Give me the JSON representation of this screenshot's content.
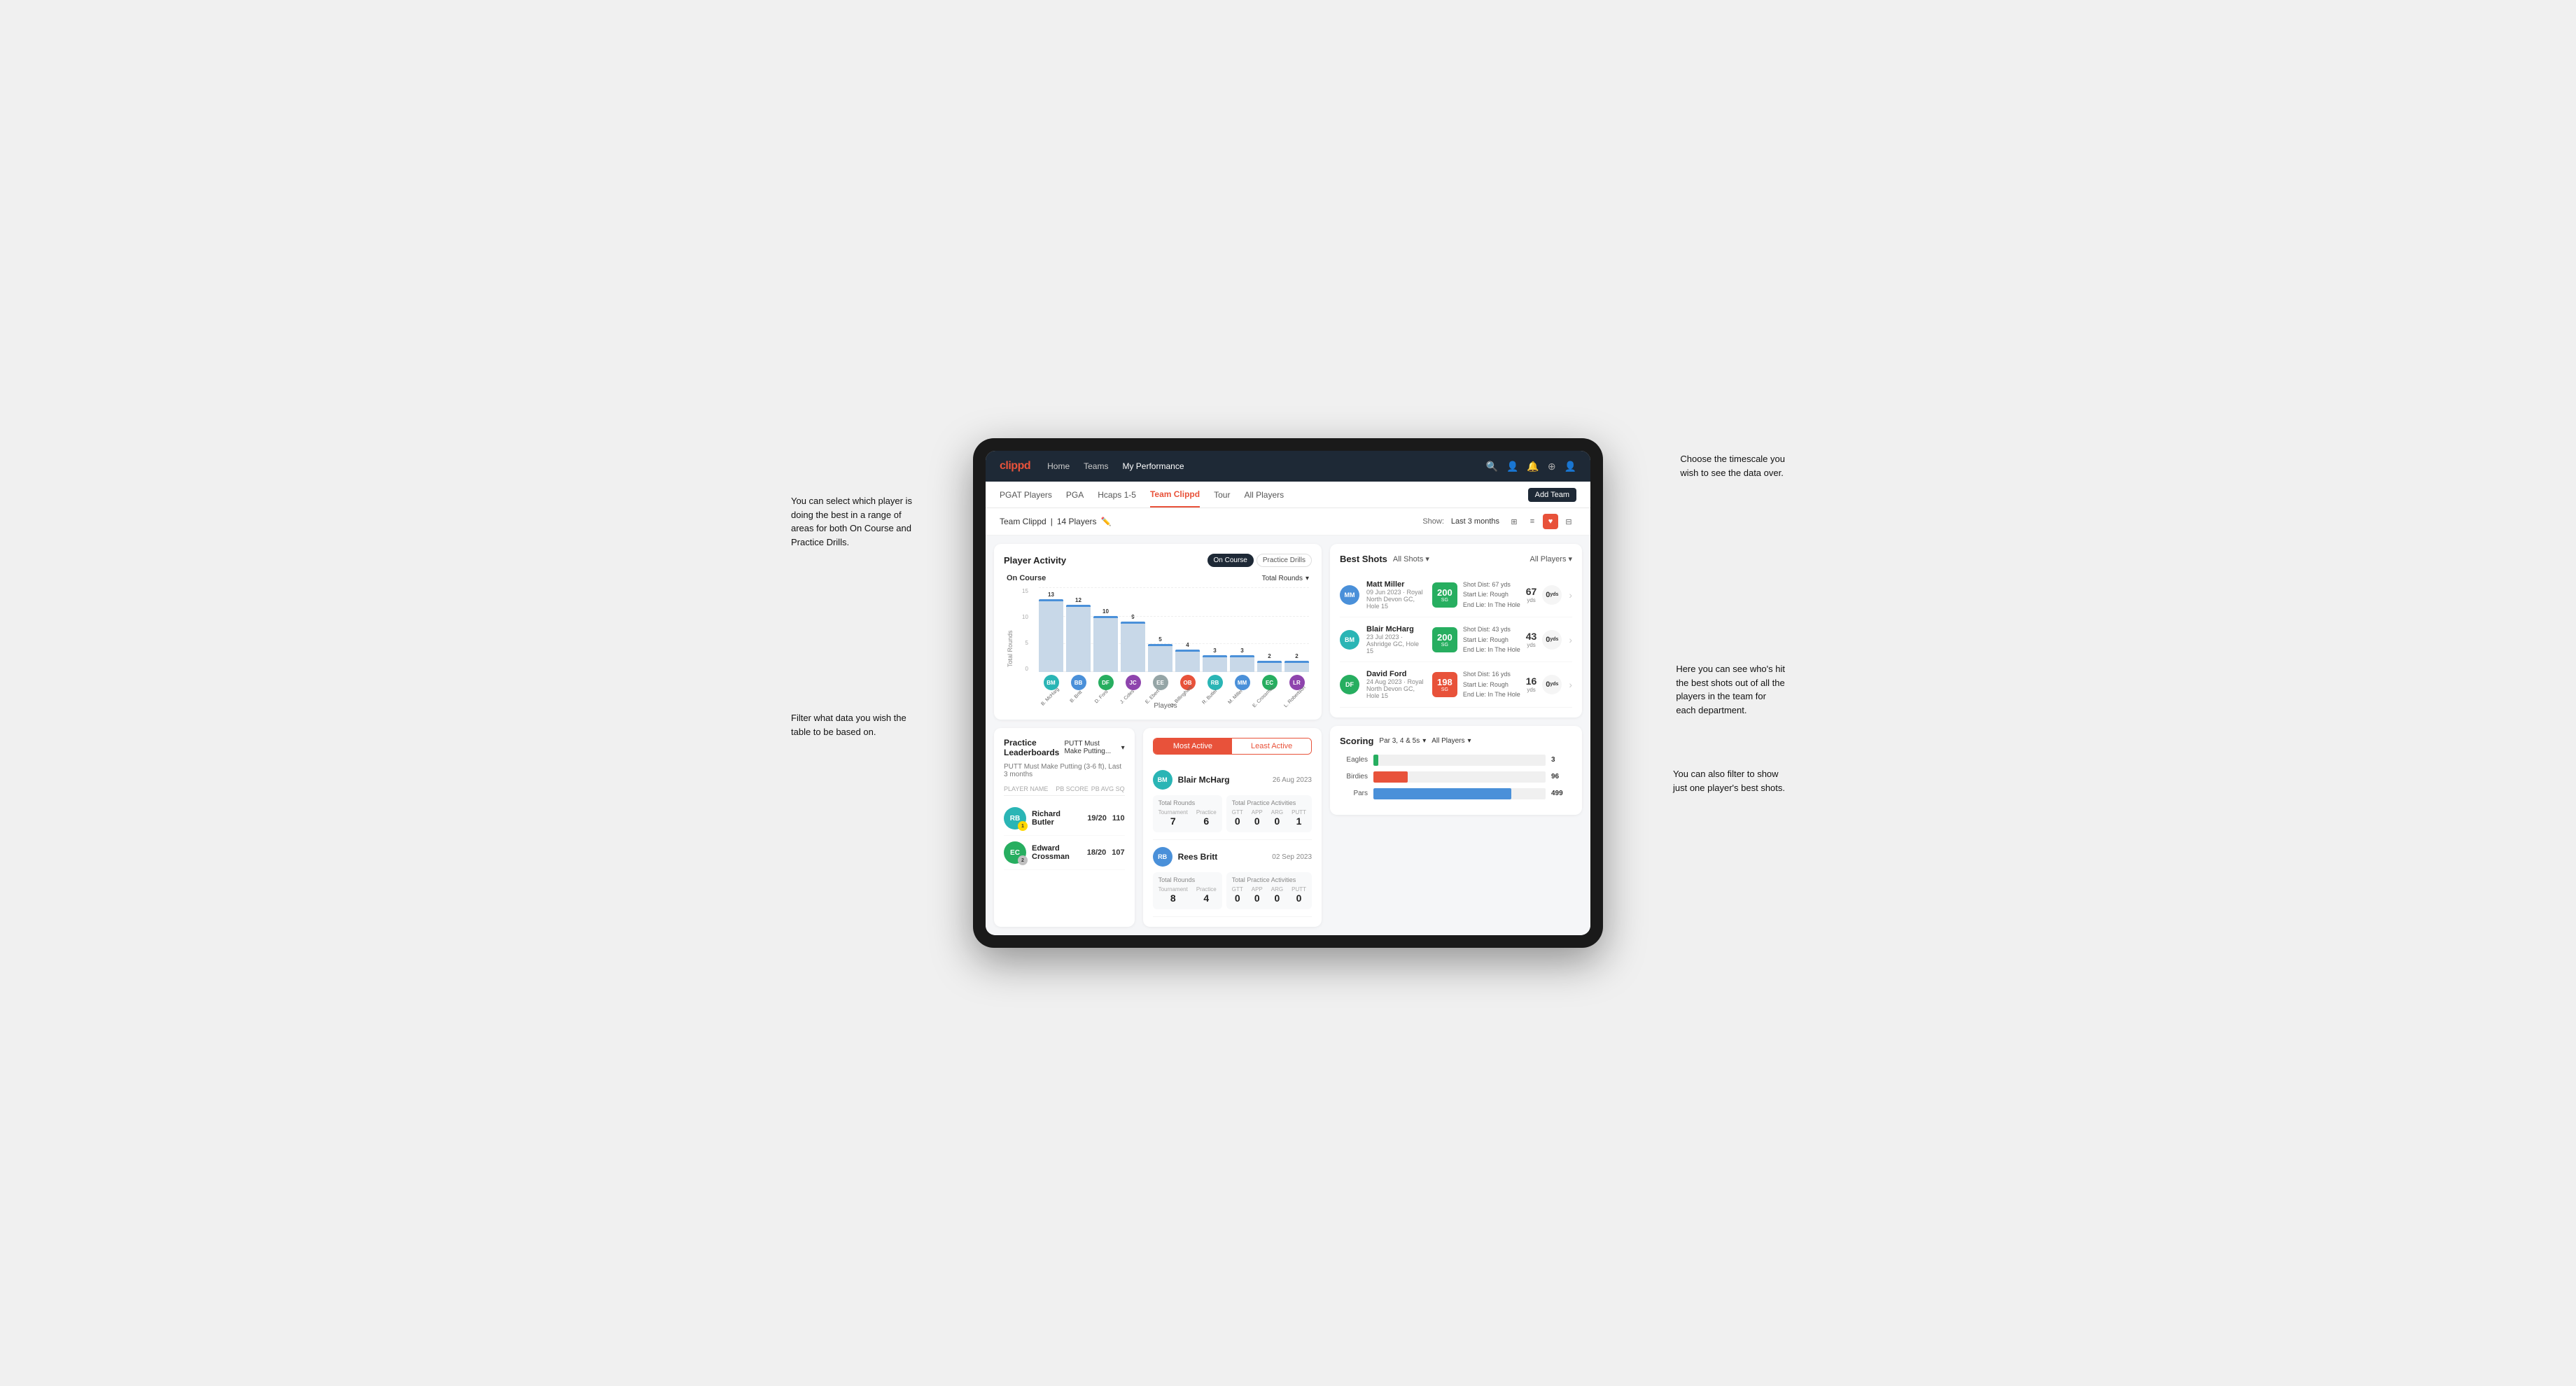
{
  "annotations": {
    "top_right": "Choose the timescale you\nwish to see the data over.",
    "left_top": "You can select which player is\ndoing the best in a range of\nareas for both On Course and\nPractice Drills.",
    "left_bottom": "Filter what data you wish the\ntable to be based on.",
    "right_mid": "Here you can see who's hit\nthe best shots out of all the\nplayers in the team for\neach department.",
    "right_bottom": "You can also filter to show\njust one player's best shots."
  },
  "nav": {
    "logo": "clippd",
    "links": [
      "Home",
      "Teams",
      "My Performance"
    ],
    "active_link": "My Performance"
  },
  "sub_nav": {
    "links": [
      "PGAT Players",
      "PGA",
      "Hcaps 1-5",
      "Team Clippd",
      "Tour",
      "All Players"
    ],
    "active": "Team Clippd",
    "add_btn": "Add Team"
  },
  "team_header": {
    "title": "Team Clippd",
    "player_count": "14 Players",
    "show_label": "Show:",
    "show_value": "Last 3 months",
    "view_options": [
      "grid",
      "list",
      "heart",
      "filter"
    ]
  },
  "player_activity": {
    "title": "Player Activity",
    "toggle_options": [
      "On Course",
      "Practice Drills"
    ],
    "active_toggle": "On Course",
    "section_title": "On Course",
    "dropdown_label": "Total Rounds",
    "y_axis": [
      "15",
      "10",
      "5",
      "0"
    ],
    "y_label": "Total Rounds",
    "x_label": "Players",
    "bars": [
      {
        "name": "B. McHarg",
        "value": 13,
        "initials": "BM",
        "color": "#2ab5b5"
      },
      {
        "name": "B. Britt",
        "value": 12,
        "initials": "BB",
        "color": "#4a90d9"
      },
      {
        "name": "D. Ford",
        "value": 10,
        "initials": "DF",
        "color": "#27ae60"
      },
      {
        "name": "J. Coles",
        "value": 9,
        "initials": "JC",
        "color": "#8e44ad"
      },
      {
        "name": "E. Ebert",
        "value": 5,
        "initials": "EE",
        "color": "#95a5a6"
      },
      {
        "name": "O. Billingham",
        "value": 4,
        "initials": "OB",
        "color": "#e8523a"
      },
      {
        "name": "R. Butler",
        "value": 3,
        "initials": "RB",
        "color": "#2ab5b5"
      },
      {
        "name": "M. Miller",
        "value": 3,
        "initials": "MM",
        "color": "#4a90d9"
      },
      {
        "name": "E. Crossman",
        "value": 2,
        "initials": "EC",
        "color": "#27ae60"
      },
      {
        "name": "L. Robertson",
        "value": 2,
        "initials": "LR",
        "color": "#8e44ad"
      }
    ]
  },
  "best_shots": {
    "title": "Best Shots",
    "filter1": "All Shots",
    "filter2": "All Players",
    "players": [
      {
        "name": "Matt Miller",
        "meta": "09 Jun 2023 · Royal North Devon GC, Hole 15",
        "badge_val": "200",
        "badge_sub": "SG",
        "badge_color": "#27ae60",
        "dist_label": "Shot Dist: 67 yds",
        "lie_start": "Start Lie: Rough",
        "lie_end": "End Lie: In The Hole",
        "stat1_val": "67",
        "stat1_unit": "yds",
        "stat2_val": "0",
        "stat2_unit": "yds",
        "avatar_color": "#4a90d9",
        "initials": "MM"
      },
      {
        "name": "Blair McHarg",
        "meta": "23 Jul 2023 · Ashridge GC, Hole 15",
        "badge_val": "200",
        "badge_sub": "SG",
        "badge_color": "#27ae60",
        "dist_label": "Shot Dist: 43 yds",
        "lie_start": "Start Lie: Rough",
        "lie_end": "End Lie: In The Hole",
        "stat1_val": "43",
        "stat1_unit": "yds",
        "stat2_val": "0",
        "stat2_unit": "yds",
        "avatar_color": "#2ab5b5",
        "initials": "BM"
      },
      {
        "name": "David Ford",
        "meta": "24 Aug 2023 · Royal North Devon GC, Hole 15",
        "badge_val": "198",
        "badge_sub": "SG",
        "badge_color": "#e8523a",
        "dist_label": "Shot Dist: 16 yds",
        "lie_start": "Start Lie: Rough",
        "lie_end": "End Lie: In The Hole",
        "stat1_val": "16",
        "stat1_unit": "yds",
        "stat2_val": "0",
        "stat2_unit": "yds",
        "avatar_color": "#27ae60",
        "initials": "DF"
      }
    ]
  },
  "leaderboard": {
    "title": "Practice Leaderboards",
    "dropdown": "PUTT Must Make Putting...",
    "sub_title": "PUTT Must Make Putting (3-6 ft), Last 3 months",
    "cols": [
      "PLAYER NAME",
      "PB SCORE",
      "PB AVG SQ"
    ],
    "players": [
      {
        "name": "Richard Butler",
        "rank": 1,
        "rank_type": "gold",
        "score": "19/20",
        "avg": "110",
        "initials": "RB",
        "color": "#2ab5b5"
      },
      {
        "name": "Edward Crossman",
        "rank": 2,
        "rank_type": "silver",
        "score": "18/20",
        "avg": "107",
        "initials": "EC",
        "color": "#27ae60"
      }
    ]
  },
  "most_active": {
    "tabs": [
      "Most Active",
      "Least Active"
    ],
    "active_tab": "Most Active",
    "players": [
      {
        "name": "Blair McHarg",
        "date": "26 Aug 2023",
        "total_rounds_label": "Total Rounds",
        "tournament_label": "Tournament",
        "practice_label": "Practice",
        "tournament_val": "7",
        "practice_val": "6",
        "practice_activities_label": "Total Practice Activities",
        "gtt_label": "GTT",
        "app_label": "APP",
        "arg_label": "ARG",
        "putt_label": "PUTT",
        "gtt_val": "0",
        "app_val": "0",
        "arg_val": "0",
        "putt_val": "1",
        "initials": "BM",
        "color": "#2ab5b5"
      },
      {
        "name": "Rees Britt",
        "date": "02 Sep 2023",
        "tournament_val": "8",
        "practice_val": "4",
        "gtt_val": "0",
        "app_val": "0",
        "arg_val": "0",
        "putt_val": "0",
        "initials": "RB",
        "color": "#4a90d9"
      }
    ]
  },
  "scoring": {
    "title": "Scoring",
    "filter1": "Par 3, 4 & 5s",
    "filter2": "All Players",
    "bars": [
      {
        "label": "Eagles",
        "count": "3",
        "color": "#27ae60",
        "pct": 3
      },
      {
        "label": "Birdies",
        "count": "96",
        "color": "#e8523a",
        "pct": 20
      },
      {
        "label": "Pars",
        "count": "499",
        "color": "#4a90d9",
        "pct": 80
      }
    ]
  }
}
